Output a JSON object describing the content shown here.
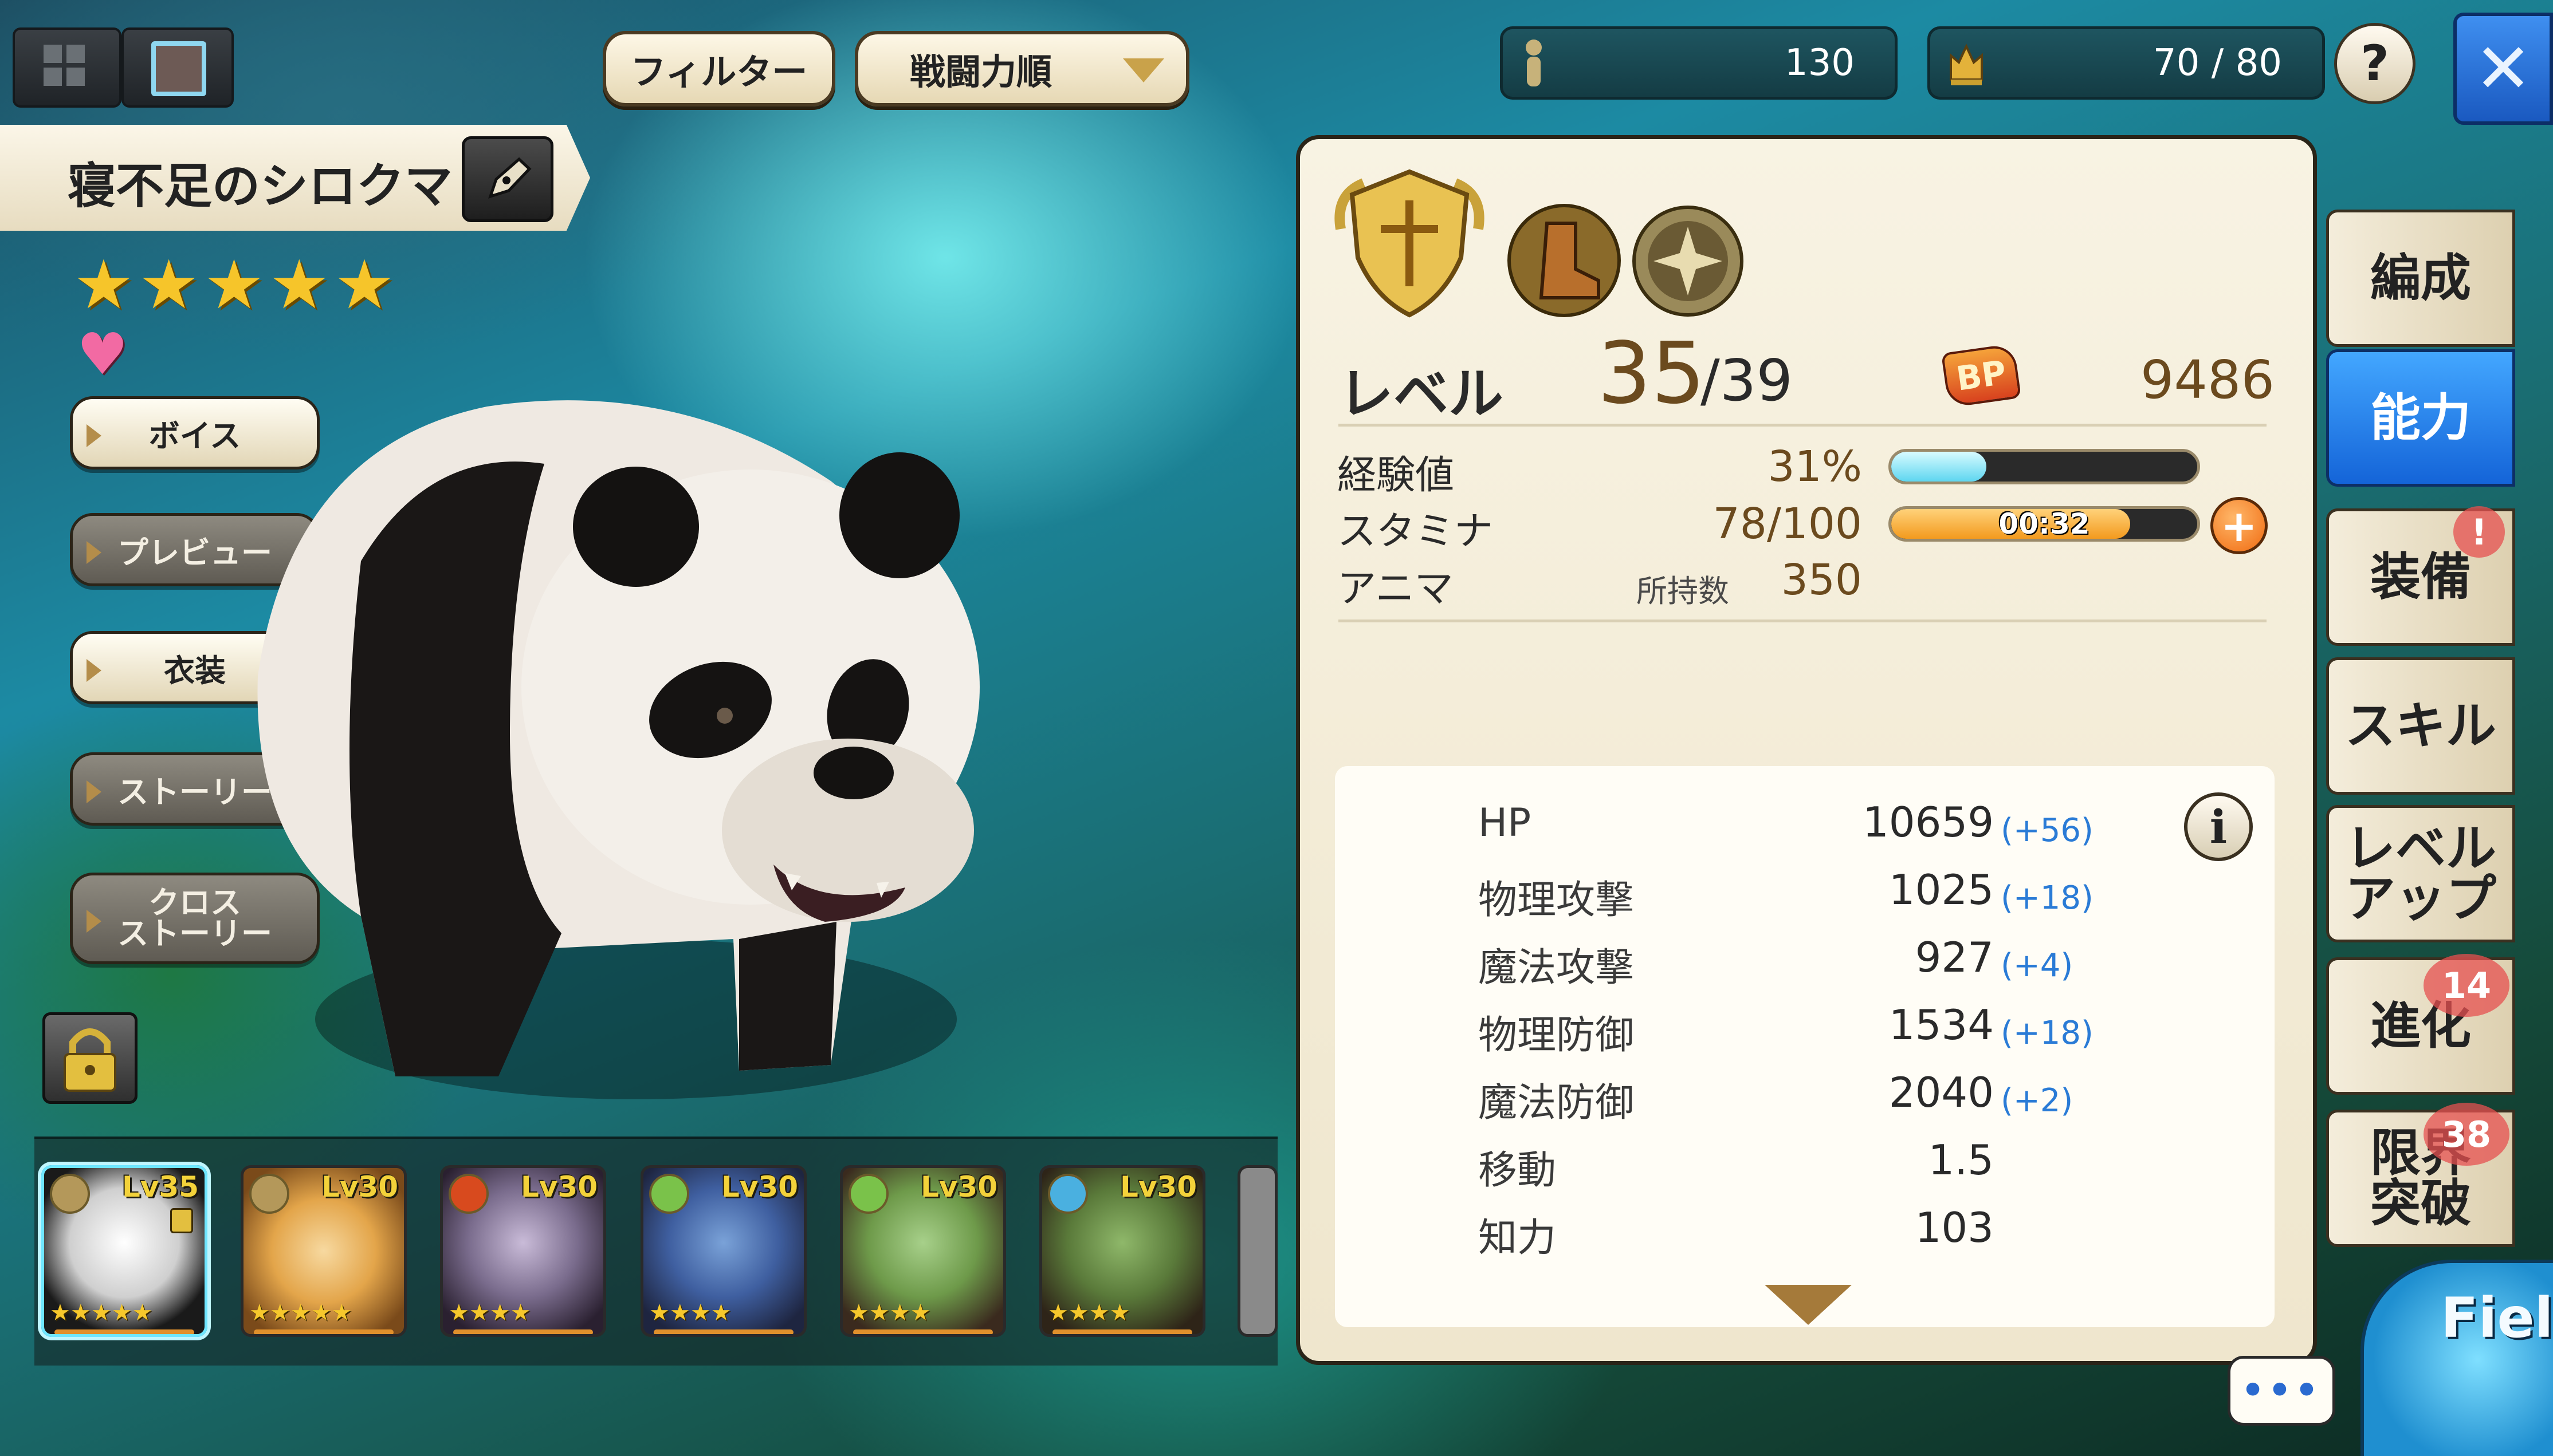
{
  "topbar": {
    "filter_label": "フィルター",
    "sort_label": "戦闘力順",
    "party_count": "130",
    "unit_capacity": "70 / 80",
    "help_label": "?",
    "close_label": "✕"
  },
  "character": {
    "name": "寝不足のシロクマ",
    "stars": 5,
    "star_glyph": "★"
  },
  "side_buttons": [
    {
      "label": "ボイス",
      "enabled": true
    },
    {
      "label": "プレビュー",
      "enabled": false
    },
    {
      "label": "衣装",
      "enabled": true
    },
    {
      "label": "ストーリー",
      "enabled": false
    },
    {
      "label": "クロス\nストーリー",
      "enabled": false
    }
  ],
  "roster": [
    {
      "level": "Lv35",
      "stars": "★★★★★",
      "selected": true,
      "locked": true
    },
    {
      "level": "Lv30",
      "stars": "★★★★★",
      "selected": false
    },
    {
      "level": "Lv30",
      "stars": "★★★★",
      "selected": false
    },
    {
      "level": "Lv30",
      "stars": "★★★★",
      "selected": false
    },
    {
      "level": "Lv30",
      "stars": "★★★★",
      "selected": false
    },
    {
      "level": "Lv30",
      "stars": "★★★★",
      "selected": false
    }
  ],
  "panel": {
    "level_label": "レベル",
    "level_current": "35",
    "level_max": "/39",
    "bp_label": "BP",
    "bp_value": "9486",
    "exp_label": "経験値",
    "exp_value": "31%",
    "exp_fraction": 0.31,
    "stamina_label": "スタミナ",
    "stamina_value": "78/100",
    "stamina_fraction": 0.78,
    "stamina_timer": "00:32",
    "anima_label": "アニマ",
    "anima_sub": "所持数",
    "anima_value": "350"
  },
  "stats": [
    {
      "label": "HP",
      "value": "10659",
      "bonus": "(+56)"
    },
    {
      "label": "物理攻撃",
      "value": "1025",
      "bonus": "(+18)"
    },
    {
      "label": "魔法攻撃",
      "value": "927",
      "bonus": "(+4)"
    },
    {
      "label": "物理防御",
      "value": "1534",
      "bonus": "(+18)"
    },
    {
      "label": "魔法防御",
      "value": "2040",
      "bonus": "(+2)"
    },
    {
      "label": "移動",
      "value": "1.5",
      "bonus": ""
    },
    {
      "label": "知力",
      "value": "103",
      "bonus": ""
    }
  ],
  "tabs": [
    {
      "label": "編成",
      "active": false
    },
    {
      "label": "能力",
      "active": true
    },
    {
      "label": "装備",
      "active": false,
      "badge": "!"
    },
    {
      "label": "スキル",
      "active": false
    },
    {
      "label": "レベル\nアップ",
      "active": false
    },
    {
      "label": "進化",
      "active": false,
      "badge": "14"
    },
    {
      "label": "限界\n突破",
      "active": false,
      "badge": "38"
    }
  ],
  "field_label": "Fiel",
  "chat_label": "•••",
  "colors": {
    "accent_blue": "#1a78f0",
    "exp_bar": "#7fe3f5",
    "stamina_bar": "#f39a1e",
    "bonus_text": "#2a7bd6",
    "level_brown": "#6b4a1e"
  }
}
